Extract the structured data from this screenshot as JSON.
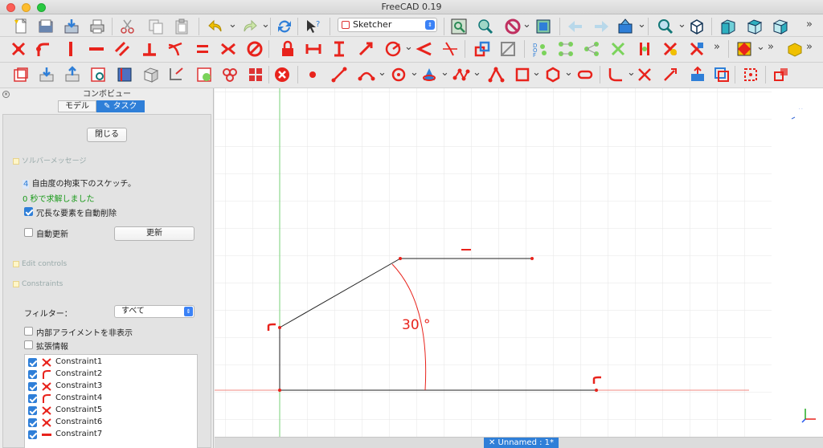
{
  "window": {
    "title": "FreeCAD 0.19"
  },
  "toolbar": {
    "workbench": "Sketcher",
    "more": "»",
    "row1_icons": [
      "new-file-icon",
      "open-file-icon",
      "save-icon",
      "print-icon",
      "cut-icon",
      "copy-icon",
      "paste-icon",
      "undo-icon",
      "redo-icon",
      "refresh-icon",
      "whats-this-icon"
    ],
    "row1b_icons": [
      "fit-all-icon",
      "fit-selection-icon",
      "draw-style-icon",
      "bounding-box-icon",
      "back-icon",
      "forward-icon",
      "link-icon",
      "std-part-icon",
      "zoom-icon",
      "axonometric-icon",
      "front-view-icon",
      "top-view-icon",
      "right-view-icon"
    ],
    "row2_icons": [
      "coincident-constraint-icon",
      "point-on-object-icon",
      "vertical-constraint-icon",
      "horizontal-constraint-icon",
      "parallel-constraint-icon",
      "perpendicular-constraint-icon",
      "tangent-constraint-icon",
      "equal-constraint-icon",
      "symmetric-constraint-icon",
      "block-constraint-icon",
      "lock-constraint-icon",
      "horizontal-distance-icon",
      "vertical-distance-icon",
      "distance-constraint-icon",
      "radius-constraint-icon",
      "angle-constraint-icon",
      "snell-law-icon",
      "toggle-driving-icon",
      "deactivate-constraint-icon",
      "dof-icon",
      "select-elements-icon",
      "conflicting-icon",
      "redundant-icon",
      "associated-icon",
      "show-hide-icon",
      "toggle-construction-icon",
      "clone-icon",
      "sketch-view-section-icon",
      "bspline-icon"
    ],
    "row3_icons": [
      "new-sketch-icon",
      "edit-sketch-icon",
      "leave-sketch-icon",
      "view-sketch-icon",
      "view-section-icon",
      "map-sketch-icon",
      "reorient-sketch-icon",
      "validate-sketch-icon",
      "merge-sketches-icon",
      "mirror-sketch-icon",
      "close-shape-icon",
      "point-icon",
      "line-icon",
      "arc-icon",
      "circle-icon",
      "conic-icon",
      "bspline-create-icon",
      "polyline-icon",
      "rectangle-icon",
      "polygon-icon",
      "slot-icon",
      "fillet-icon",
      "trim-icon",
      "extend-icon",
      "external-geometry-icon",
      "carbon-copy-icon",
      "construction-mode-icon",
      "external-link-icon"
    ]
  },
  "combo_view": {
    "title": "コンボビュー",
    "tabs": [
      {
        "label": "モデル"
      },
      {
        "label": "タスク"
      }
    ]
  },
  "task": {
    "close_button": "閉じる",
    "solver_section": "ソルバーメッセージ",
    "dof_count": "4",
    "dof_text": "自由度の拘束下のスケッチ。",
    "solve_message": "0 秒で求解しました",
    "auto_remove_label": "冗長な要素を自動削除",
    "auto_remove_checked": true,
    "auto_update_label": "自動更新",
    "auto_update_checked": false,
    "update_button": "更新",
    "edit_controls_section": "Edit controls",
    "constraints_section": "Constraints",
    "filter_label": "フィルター：",
    "filter_value": "すべて",
    "hide_internal_label": "内部アライメントを非表示",
    "extended_info_label": "拡張情報",
    "constraints": [
      {
        "name": "Constraint1",
        "icon": "coincident-icon",
        "checked": true
      },
      {
        "name": "Constraint2",
        "icon": "point-on-object-icon",
        "checked": true
      },
      {
        "name": "Constraint3",
        "icon": "coincident-icon",
        "checked": true
      },
      {
        "name": "Constraint4",
        "icon": "point-on-object-icon",
        "checked": true
      },
      {
        "name": "Constraint5",
        "icon": "coincident-icon",
        "checked": true
      },
      {
        "name": "Constraint6",
        "icon": "coincident-icon",
        "checked": true
      },
      {
        "name": "Constraint7",
        "icon": "horizontal-icon",
        "checked": true
      }
    ]
  },
  "sketch": {
    "angle_label": "30 °"
  },
  "document_tab": {
    "label": "✕ Unnamed : 1*"
  },
  "colors": {
    "accent": "#2f7fd8",
    "constraint_red": "#e8231c",
    "solver_green": "#1a9a1a"
  }
}
